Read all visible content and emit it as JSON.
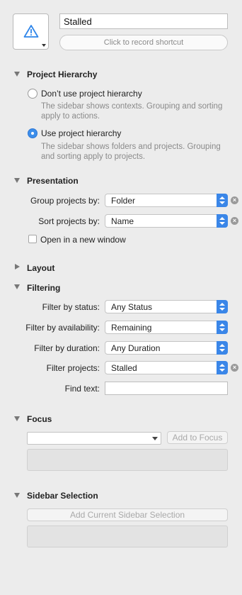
{
  "header": {
    "perspective_name": "Stalled",
    "shortcut_label": "Click to record shortcut",
    "icon": "warning-triangle-icon",
    "icon_color": "#2f86ea"
  },
  "project_hierarchy": {
    "title": "Project Hierarchy",
    "options": [
      {
        "label": "Don’t use project hierarchy",
        "description": "The sidebar shows contexts. Grouping and sorting apply to actions.",
        "selected": false
      },
      {
        "label": "Use project hierarchy",
        "description": "The sidebar shows folders and projects. Grouping and sorting apply to projects.",
        "selected": true
      }
    ]
  },
  "presentation": {
    "title": "Presentation",
    "group_label": "Group projects by:",
    "group_value": "Folder",
    "sort_label": "Sort projects by:",
    "sort_value": "Name",
    "new_window_label": "Open in a new window",
    "new_window_checked": false
  },
  "layout": {
    "title": "Layout"
  },
  "filtering": {
    "title": "Filtering",
    "status_label": "Filter by status:",
    "status_value": "Any Status",
    "availability_label": "Filter by availability:",
    "availability_value": "Remaining",
    "duration_label": "Filter by duration:",
    "duration_value": "Any Duration",
    "projects_label": "Filter projects:",
    "projects_value": "Stalled",
    "find_label": "Find text:",
    "find_value": ""
  },
  "focus": {
    "title": "Focus",
    "combo_value": "",
    "add_button": "Add to Focus"
  },
  "sidebar_selection": {
    "title": "Sidebar Selection",
    "add_button": "Add Current Sidebar Selection"
  },
  "colors": {
    "accent": "#3a86e8",
    "background": "#ececec"
  }
}
